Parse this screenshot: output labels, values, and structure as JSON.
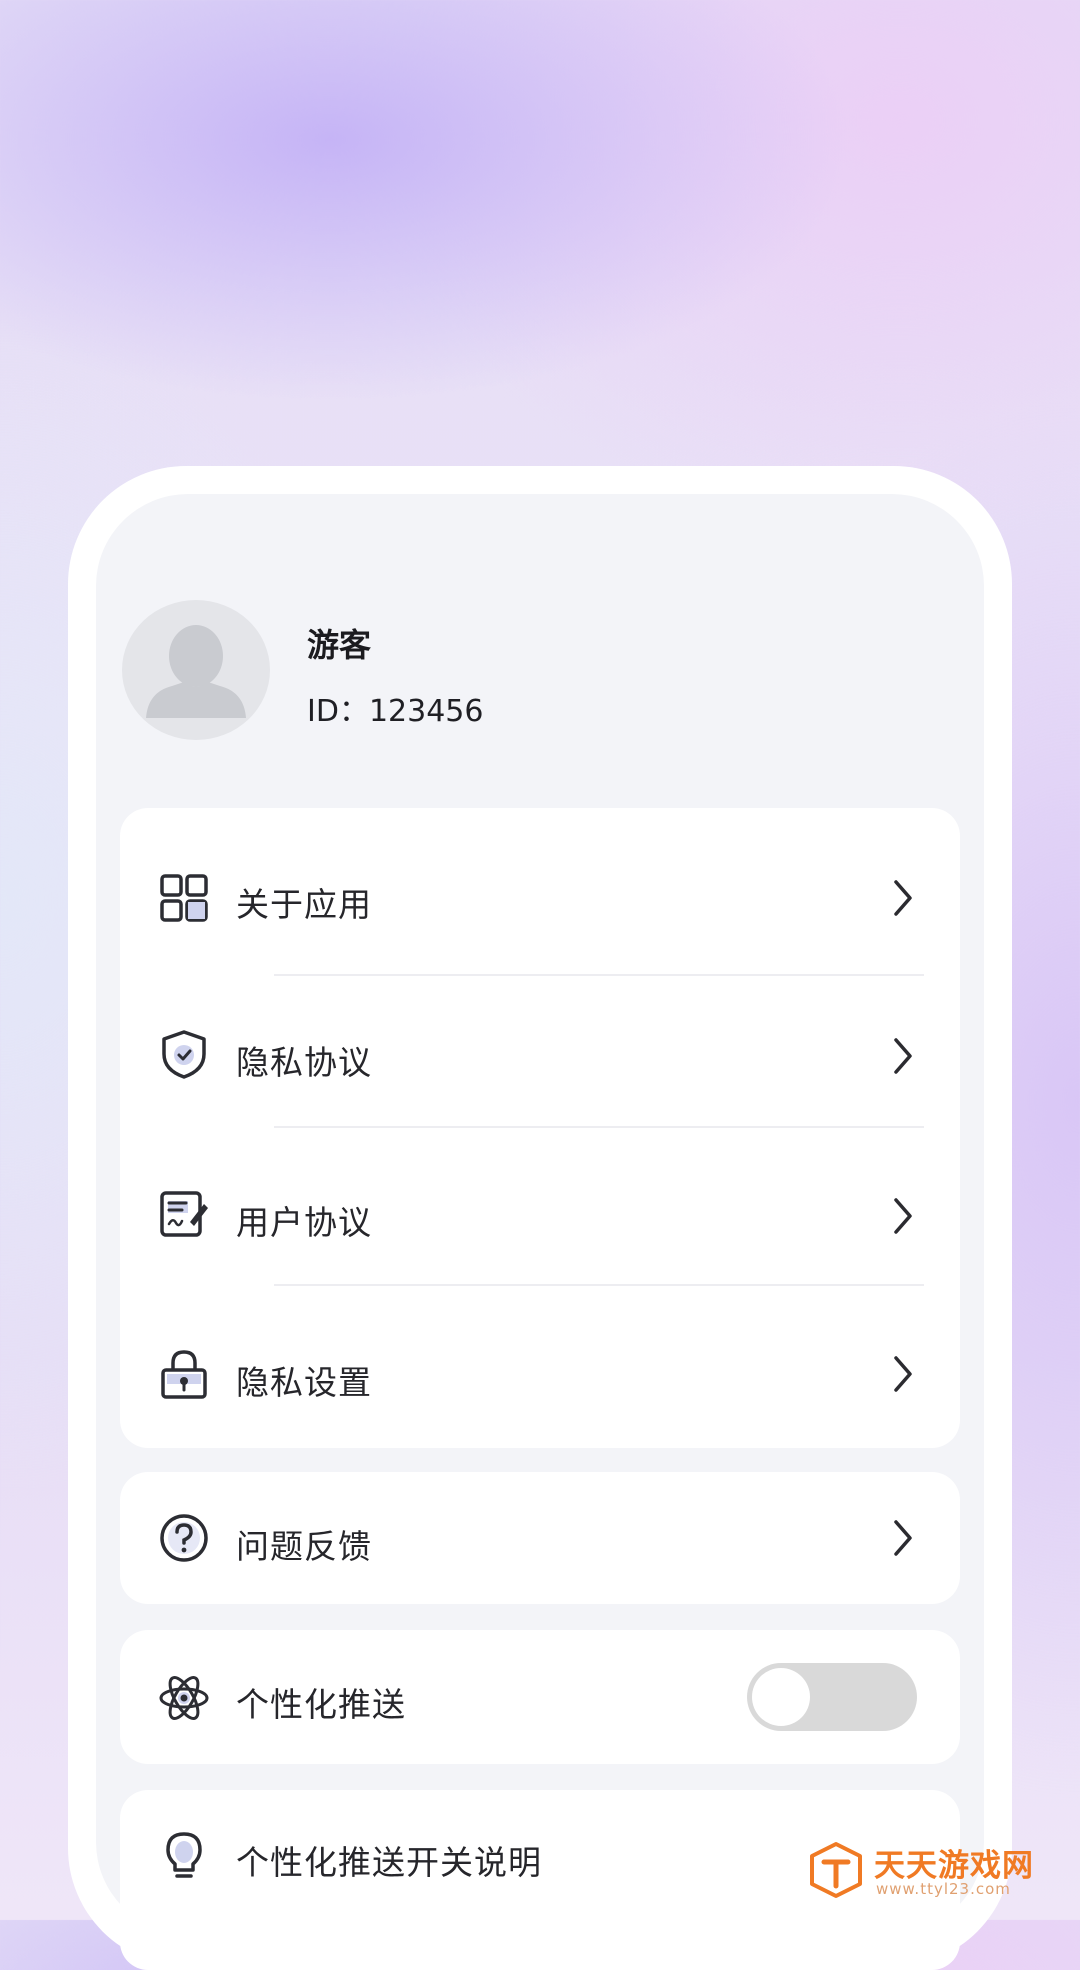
{
  "profile": {
    "name": "游客",
    "id_text": "ID：123456"
  },
  "menu_group_1": [
    {
      "label": "关于应用",
      "icon": "grid-icon"
    },
    {
      "label": "隐私协议",
      "icon": "shield-check-icon"
    },
    {
      "label": "用户协议",
      "icon": "document-sign-icon"
    },
    {
      "label": "隐私设置",
      "icon": "lock-icon"
    }
  ],
  "feedback": {
    "label": "问题反馈",
    "icon": "question-circle-icon"
  },
  "personalized_push": {
    "label": "个性化推送",
    "icon": "atom-icon",
    "enabled": false
  },
  "push_explanation": {
    "label": "个性化推送开关说明",
    "icon": "lightbulb-icon"
  },
  "watermark": {
    "brand": "天天游戏网",
    "url": "www.ttyl23.com",
    "color": "#f07a24"
  }
}
